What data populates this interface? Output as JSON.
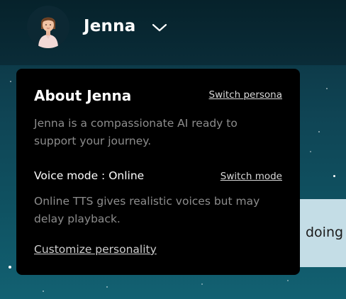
{
  "header": {
    "persona_name": "Jenna"
  },
  "chat": {
    "partial_message": "doing"
  },
  "popover": {
    "title": "About Jenna",
    "switch_persona_label": "Switch persona",
    "description": "Jenna is a compassionate AI ready to support your journey.",
    "voice_mode_label": "Voice mode : Online",
    "switch_mode_label": "Switch mode",
    "voice_description": "Online TTS gives realistic voices but may delay playback.",
    "customize_label": "Customize personality"
  },
  "icons": {
    "avatar": "persona-avatar",
    "dropdown": "chevron-down-icon"
  },
  "colors": {
    "background_top": "#0b2f3c",
    "background_bottom": "#126172",
    "panel": "#000000",
    "chat_bubble": "#c4dde6"
  }
}
